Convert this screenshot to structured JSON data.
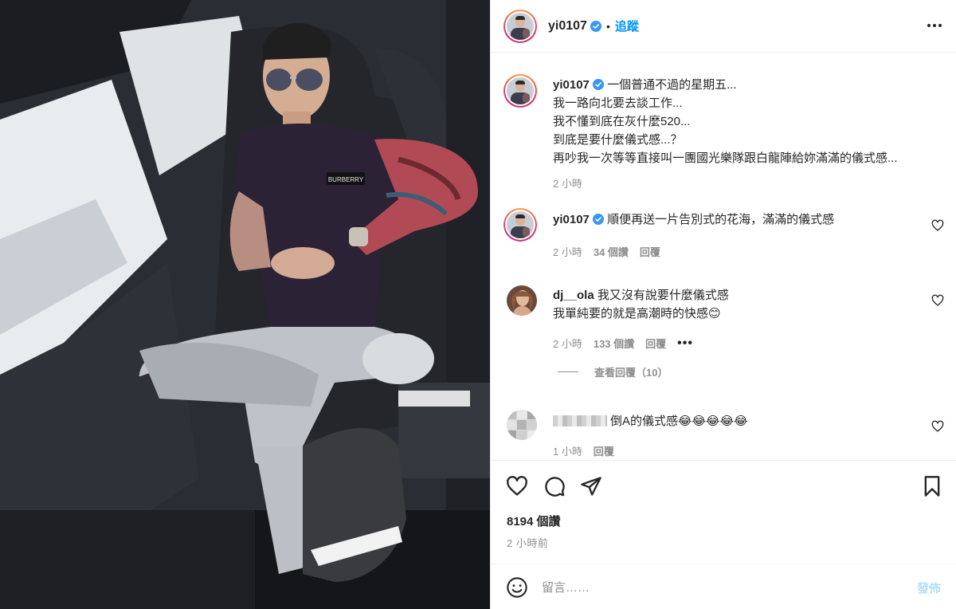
{
  "post": {
    "author": "yi0107",
    "follow_label": "追蹤",
    "separator": "•"
  },
  "caption": {
    "username": "yi0107",
    "lines": [
      "一個普通不過的星期五...",
      "我一路向北要去談工作...",
      "我不懂到底在灰什麼520...",
      "到底是要什麼儀式感...？",
      "再吵我一次等等直接叫一團國光樂隊跟白龍陣給妳滿滿的儀式感..."
    ],
    "time": "2 小時"
  },
  "comments": [
    {
      "username": "yi0107",
      "lines": [
        "順便再送一片告別式的花海，滿滿的儀式感"
      ],
      "time": "2 小時",
      "likes": "34 個讚",
      "reply_label": "回覆"
    },
    {
      "username": "dj__ola",
      "lines": [
        "我又沒有說要什麼儀式感",
        "我單純要的就是高潮時的快感😊"
      ],
      "time": "2 小時",
      "likes": "133 個讚",
      "reply_label": "回覆",
      "view_replies": "查看回覆（10）"
    },
    {
      "username": "",
      "lines": [
        "倒A的儀式感😂😂😂😂😂"
      ],
      "time": "1 小時",
      "reply_label": "回覆"
    }
  ],
  "stats": {
    "likes": "8194 個讚",
    "posted": "2 小時前"
  },
  "composer": {
    "placeholder": "留言……",
    "post_label": "發佈"
  },
  "photo_text": {
    "shirt_brand": "BURBERRY"
  },
  "icons": {
    "verified": "verified-badge-icon",
    "like": "heart-icon",
    "comment": "comment-bubble-icon",
    "share": "paper-plane-icon",
    "save": "bookmark-icon",
    "emoji": "smiley-icon",
    "more": "more-options-icon"
  },
  "colors": {
    "accent": "#0095f6",
    "verified": "#3897f0",
    "post_button_disabled": "#b2dffc",
    "muted": "#8e8e8e"
  }
}
